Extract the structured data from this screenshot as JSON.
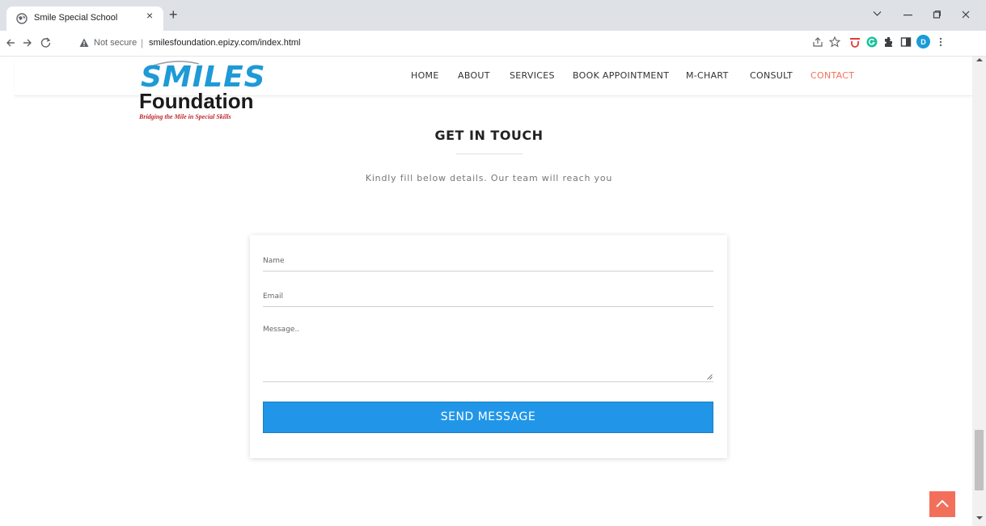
{
  "browser": {
    "tab_title": "Smile Special School",
    "tab_close": "×",
    "new_tab": "+",
    "security_label": "Not secure",
    "url_separator": "|",
    "url": "smilesfoundation.epizy.com/index.html",
    "profile_initial": "D"
  },
  "site": {
    "logo": {
      "name": "SMILES",
      "subname": "Foundation",
      "tagline": "Bridging the Mile in Special Skills"
    },
    "nav": [
      {
        "label": "HOME"
      },
      {
        "label": "ABOUT"
      },
      {
        "label": "SERVICES"
      },
      {
        "label": "BOOK APPOINTMENT"
      },
      {
        "label": "M-CHART"
      },
      {
        "label": "CONSULT"
      },
      {
        "label": "CONTACT",
        "active": true
      }
    ]
  },
  "contact": {
    "title": "GET IN TOUCH",
    "subtitle": "Kindly fill below details. Our team will reach you",
    "form": {
      "name_placeholder": "Name",
      "email_placeholder": "Email",
      "message_placeholder": "Message..",
      "submit_label": "SEND MESSAGE"
    }
  },
  "colors": {
    "accent": "#f2705b",
    "button": "#2196e8",
    "logo_blue": "#1e9ad6",
    "logo_tagline": "#c0272d"
  },
  "icons": [
    "globe-icon",
    "back-arrow-icon",
    "forward-arrow-icon",
    "reload-icon",
    "warning-icon",
    "share-icon",
    "bookmark-star-icon",
    "extension-icon",
    "sidebar-icon",
    "chevron-up-icon"
  ]
}
